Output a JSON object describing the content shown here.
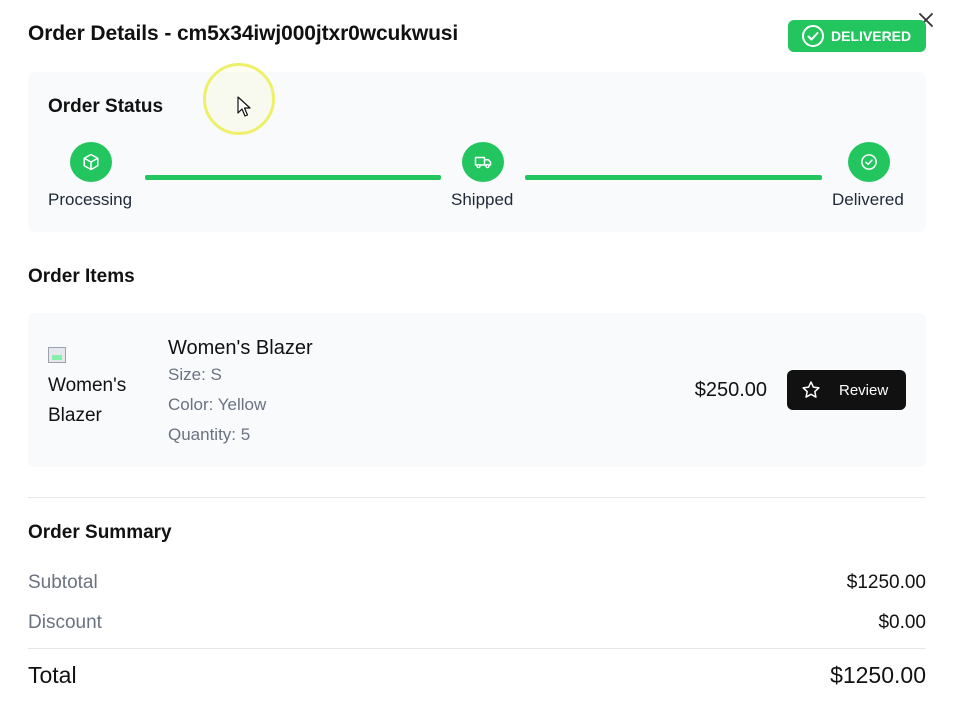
{
  "header": {
    "title_prefix": "Order Details - ",
    "order_id": "cm5x34iwj000jtxr0wcukwusi",
    "status_badge": "DELIVERED",
    "close_icon": "close-icon"
  },
  "order_status": {
    "title": "Order Status",
    "steps": [
      {
        "label": "Processing",
        "icon": "package-icon"
      },
      {
        "label": "Shipped",
        "icon": "truck-icon"
      },
      {
        "label": "Delivered",
        "icon": "check-circle-icon"
      }
    ]
  },
  "order_items": {
    "title": "Order Items",
    "items": [
      {
        "image_alt": "Women's Blazer",
        "name": "Women's Blazer",
        "size": "Size: S",
        "color": "Color: Yellow",
        "quantity": "Quantity: 5",
        "price": "$250.00",
        "review_label": "Review"
      }
    ]
  },
  "order_summary": {
    "title": "Order Summary",
    "subtotal_label": "Subtotal",
    "subtotal_value": "$1250.00",
    "discount_label": "Discount",
    "discount_value": "$0.00",
    "total_label": "Total",
    "total_value": "$1250.00"
  },
  "colors": {
    "accent_green": "#22c55e",
    "button_dark": "#111111",
    "card_bg": "#f8fafc",
    "muted_text": "#6b7280"
  }
}
